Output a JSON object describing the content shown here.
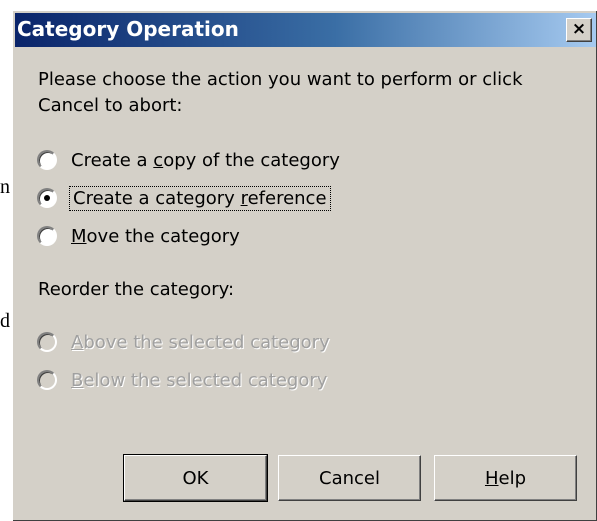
{
  "dialog": {
    "title": "Category Operation",
    "close_glyph": "×",
    "instruction_line1": "Please choose the action you want to perform or click",
    "instruction_line2": "Cancel to abort:",
    "actions": [
      {
        "pre": "Create a ",
        "accel": "c",
        "post": "opy of the category",
        "checked": false
      },
      {
        "pre": "Create a category ",
        "accel": "r",
        "post": "eference",
        "checked": true
      },
      {
        "pre": "",
        "accel": "M",
        "post": "ove the category",
        "checked": false
      }
    ],
    "reorder_label": "Reorder the category:",
    "reorder_options": [
      {
        "pre": "",
        "accel": "A",
        "post": "bove the selected category",
        "enabled": false
      },
      {
        "pre": "",
        "accel": "B",
        "post": "elow the selected category",
        "enabled": false
      }
    ],
    "buttons": {
      "ok": "OK",
      "cancel": "Cancel",
      "help_accel": "H",
      "help_rest": "elp"
    }
  },
  "background": {
    "char1": "n",
    "char2": "d"
  },
  "colors": {
    "face": "#d4d0c8",
    "title_start": "#0a246a",
    "title_end": "#a6caf0",
    "disabled_text": "#a0a0a0"
  }
}
